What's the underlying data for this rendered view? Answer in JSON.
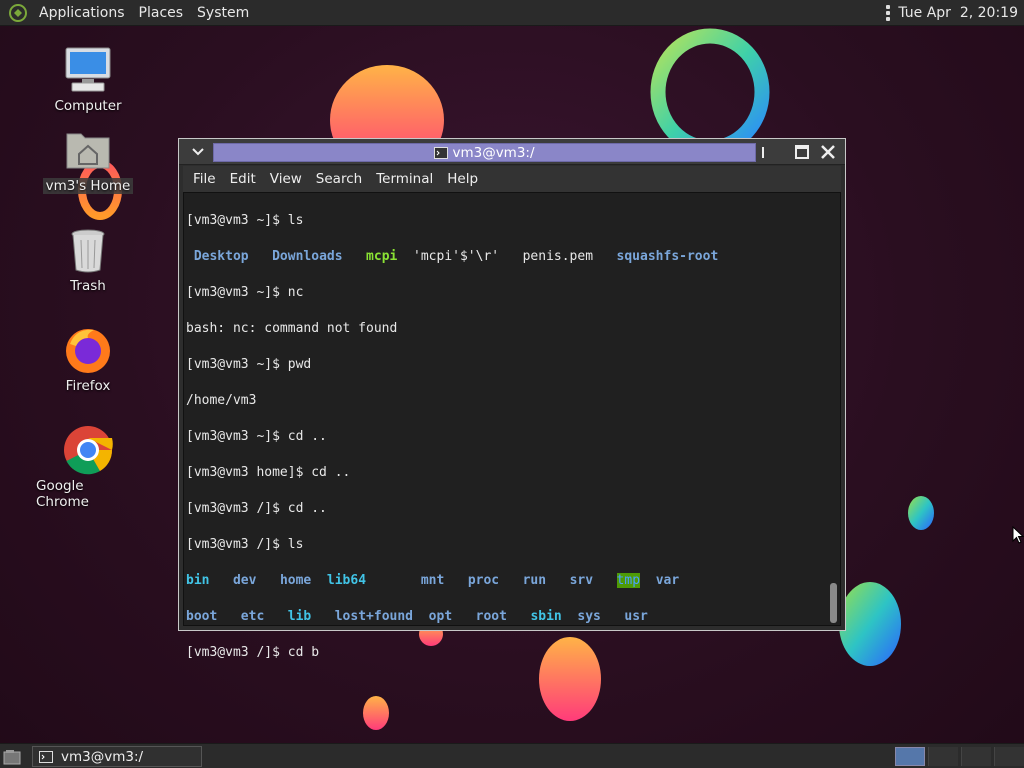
{
  "top_panel": {
    "menus": [
      "Applications",
      "Places",
      "System"
    ],
    "clock": "Tue Apr  2, 20:19"
  },
  "desktop_icons": [
    {
      "label": "Computer",
      "icon": "computer-icon"
    },
    {
      "label": "vm3's Home",
      "icon": "home-folder-icon"
    },
    {
      "label": "Trash",
      "icon": "trash-icon"
    },
    {
      "label": "Firefox",
      "icon": "firefox-icon"
    },
    {
      "label": "Google Chrome",
      "icon": "chrome-icon"
    }
  ],
  "terminal": {
    "title": "vm3@vm3:/",
    "menu": [
      "File",
      "Edit",
      "View",
      "Search",
      "Terminal",
      "Help"
    ],
    "lines": {
      "l1": "[vm3@vm3 ~]$ ls",
      "l2_items": [
        "Desktop",
        "Downloads",
        "mcpi",
        "'mcpi'$'\\r'",
        "penis.pem",
        "squashfs-root"
      ],
      "l3": "[vm3@vm3 ~]$ nc",
      "l4": "bash: nc: command not found",
      "l5": "[vm3@vm3 ~]$ pwd",
      "l6": "/home/vm3",
      "l7": "[vm3@vm3 ~]$ cd ..",
      "l8": "[vm3@vm3 home]$ cd ..",
      "l9": "[vm3@vm3 /]$ cd ..",
      "l10": "[vm3@vm3 /]$ ls",
      "row1": [
        "bin",
        "dev",
        "home",
        "lib64",
        "mnt",
        "proc",
        "run",
        "srv",
        "tmp",
        "var"
      ],
      "row2": [
        "boot",
        "etc",
        "lib",
        "lost+found",
        "opt",
        "root",
        "sbin",
        "sys",
        "usr"
      ],
      "l13": "[vm3@vm3 /]$ cd b"
    }
  },
  "taskbar": {
    "task_label": "vm3@vm3:/"
  },
  "colors": {
    "dir_blue": "#7aa6da",
    "exec_green": "#8ae234",
    "link_cyan": "#41c4e6",
    "tmp_bg": "#4e9a06",
    "title_active": "#8a86c8"
  }
}
